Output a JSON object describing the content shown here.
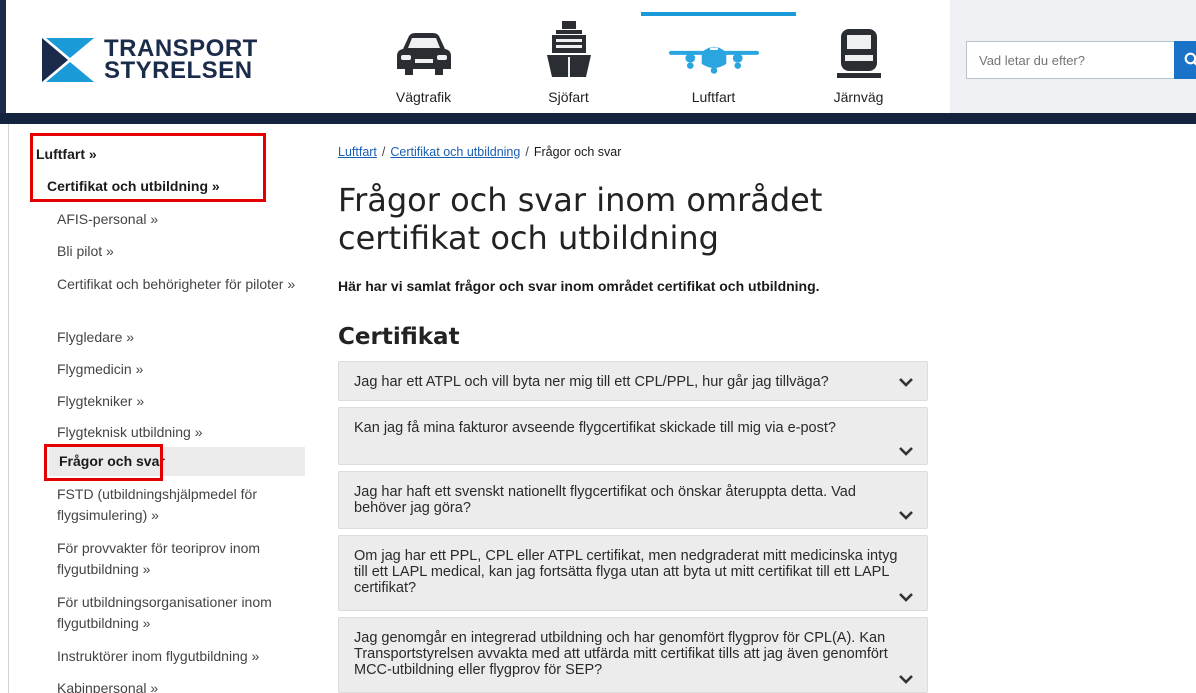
{
  "header": {
    "logo_line1": "TRANSPORT",
    "logo_line2": "STYRELSEN",
    "nav": [
      {
        "label": "Vägtrafik",
        "icon": "car-icon"
      },
      {
        "label": "Sjöfart",
        "icon": "ship-icon"
      },
      {
        "label": "Luftfart",
        "icon": "airplane-icon",
        "active": true
      },
      {
        "label": "Järnväg",
        "icon": "train-icon"
      }
    ],
    "search_placeholder": "Vad letar du efter?",
    "search_icon": "search-icon",
    "accent_color": "#1a9bd7",
    "brand_color": "#1b2b4a"
  },
  "sidebar": {
    "root": "Luftfart »",
    "section": "Certifikat och utbildning »",
    "items": [
      "AFIS-personal »",
      "Bli pilot »",
      "Certifikat och behörigheter för piloter »",
      "Flygledare  »",
      "Flygmedicin »",
      "Flygtekniker »",
      "Flygteknisk utbildning »",
      "Frågor och svar",
      "FSTD (utbildningshjälpmedel för flygsimulering) »",
      "För provvakter för teoriprov inom flygutbildning »",
      "För utbildningsorganisationer inom flygutbildning »",
      "Instruktörer inom flygutbildning »",
      "Kabinpersonal »"
    ],
    "active_index": 7
  },
  "breadcrumb": {
    "items": [
      "Luftfart",
      "Certifikat och utbildning"
    ],
    "current": "Frågor och svar",
    "separator": "/"
  },
  "main": {
    "title": "Frågor och svar inom området certifikat och utbildning",
    "intro": "Här har vi samlat frågor och svar inom området certifikat och utbildning.",
    "section": "Certifikat",
    "faqs": [
      "Jag har ett ATPL och vill byta ner mig till ett CPL/PPL, hur går jag tillväga?",
      "Kan jag få mina fakturor avseende flygcertifikat skickade till mig via e-post?",
      "Jag har haft ett svenskt nationellt flygcertifikat och önskar återuppta detta. Vad behöver jag göra?",
      "Om jag har ett PPL, CPL eller ATPL certifikat, men nedgraderat mitt medicinska intyg till ett LAPL medical, kan jag fortsätta flyga utan att byta ut mitt certifikat till ett LAPL certifikat?",
      "Jag genomgår en integrerad utbildning och har genomfört flygprov för CPL(A). Kan Transportstyrelsen avvakta med att utfärda mitt certifikat tills att jag även genomfört MCC-utbildning eller flygprov för SEP?"
    ]
  },
  "highlight_color": "#e50000"
}
